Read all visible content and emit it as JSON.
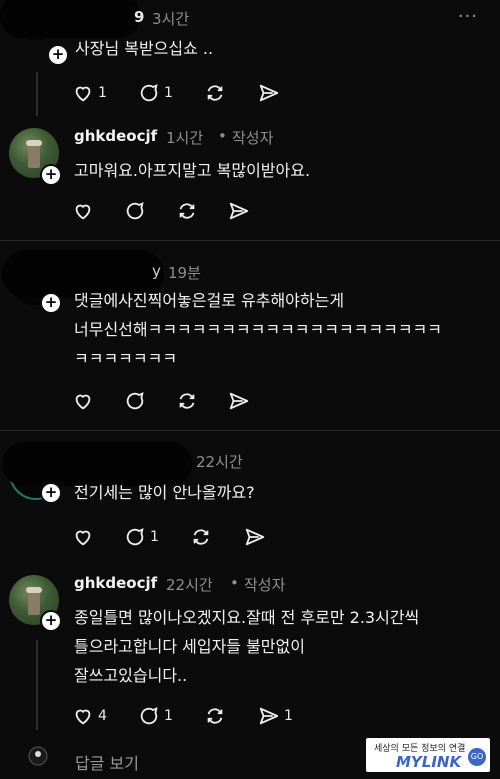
{
  "comments": [
    {
      "username": "",
      "time": "3시간",
      "partial_time": "9",
      "badge": "",
      "text": [
        "사장님 복받으십쇼 .."
      ],
      "likes": "1",
      "replies": "1",
      "reposts": "",
      "shares": ""
    },
    {
      "username": "ghkdeocjf",
      "time": "1시간",
      "badge": "작성자",
      "text": [
        "고마워요.아프지말고 복많이받아요."
      ],
      "likes": "",
      "replies": "",
      "reposts": "",
      "shares": ""
    },
    {
      "username": "",
      "time": "19분",
      "partial_time": "y",
      "badge": "",
      "text": [
        "댓글에사진찍어놓은걸로 유추해야하는게",
        "너무신선해ㅋㅋㅋㅋㅋㅋㅋㅋㅋㅋㅋㅋㅋㅋㅋㅋㅋㅋㅋㅋ",
        "ㅋㅋㅋㅋㅋㅋㅋ"
      ],
      "likes": "",
      "replies": "",
      "reposts": "",
      "shares": ""
    },
    {
      "username": "",
      "time": "22시간",
      "partial_time": "",
      "badge": "",
      "text": [
        "전기세는 많이 안나올까요?"
      ],
      "likes": "",
      "replies": "1",
      "reposts": "",
      "shares": ""
    },
    {
      "username": "ghkdeocjf",
      "time": "22시간",
      "badge": "작성자",
      "text": [
        "종일틀면 많이나오겠지요.잘때 전 후로만 2.3시간씩",
        "틀으라고합니다 세입자들 불만없이",
        "잘쓰고있습니다.."
      ],
      "likes": "4",
      "replies": "1",
      "reposts": "",
      "shares": "1"
    }
  ],
  "separator": "•",
  "more_label": "···",
  "footer": {
    "label": "답글 보기"
  },
  "ad": {
    "line1": "세상의 모든 정보의 연결",
    "brand": "MYLINK",
    "go": "GO"
  },
  "colors": {
    "background": "#0b0b0b",
    "text": "#f2f2f2",
    "muted": "#8e8e8e",
    "separator": "#262626"
  }
}
